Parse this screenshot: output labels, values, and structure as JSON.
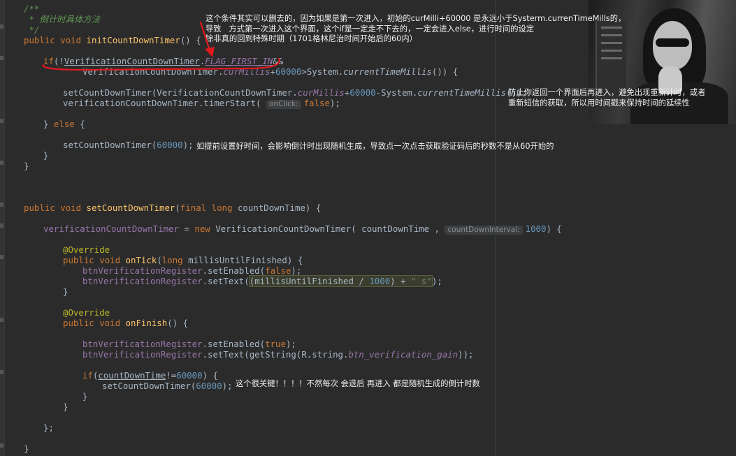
{
  "code": {
    "comment_open": "/**",
    "comment_title": " * 倒计时具体方法",
    "comment_close": " */",
    "kw_public": "public",
    "kw_void": "void",
    "kw_if": "if",
    "kw_else": "else",
    "kw_final": "final",
    "kw_long": "long",
    "kw_new": "new",
    "kw_false": "false",
    "kw_true": "true",
    "m_initCountDownTimer": "initCountDownTimer",
    "m_setCountDownTimer": "setCountDownTimer",
    "m_onTick": "onTick",
    "m_onFinish": "onFinish",
    "cls_vcdt": "VerificationCountDownTimer",
    "fld_flag_first_in": "FLAG_FIRST_IN",
    "fld_cur_millis": "curMillis",
    "fld_btn_gain": "btn_verification_gain",
    "num_60000": "60000",
    "num_1000": "1000",
    "var_countDownTime": "countDownTime",
    "var_millis": "millisUntilFinished",
    "var_vcdt": "verificationCountDownTimer",
    "var_btn": "btnVerificationRegister",
    "ann_override": "@Override",
    "str_s": "\" s\"",
    "sys_millis": "currentTimeMillis",
    "hint_onclick": "onClick:",
    "hint_interval": "countDownInterval:"
  },
  "notes": {
    "top_line1": "这个条件其实可以删去的，因为如果是第一次进入，初始的curMilli+60000 是永远小于Systerm.currenTimeMills的，",
    "top_line2": "导致   方式第一次进入这个界面，这个if是一定走不下去的，一定会进入else，进行时间的设定",
    "top_line3": "除非真的回到特殊时期（1701格林尼治时间开始后的60内）",
    "right_line1": "防止你返回一个界面后再进入，避免出现重新计时，或者",
    "right_line2": "重新短信的获取，所以用时间戳来保持时间的延续性",
    "mid": "如提前设置好时间，会影响倒计时出现随机生成，导致点一次点击获取验证码后的秒数不是从60开始的",
    "bottom": "这个很关键！！！！不然每次 会退后 再进入 都是随机生成的倒计时数"
  },
  "colors": {
    "background": "#2b2b2b",
    "keyword": "#cc7832",
    "method": "#ffc66d",
    "number": "#6897bb",
    "field": "#9876aa",
    "comment": "#629755",
    "annotation_marker": "#e0191e"
  }
}
